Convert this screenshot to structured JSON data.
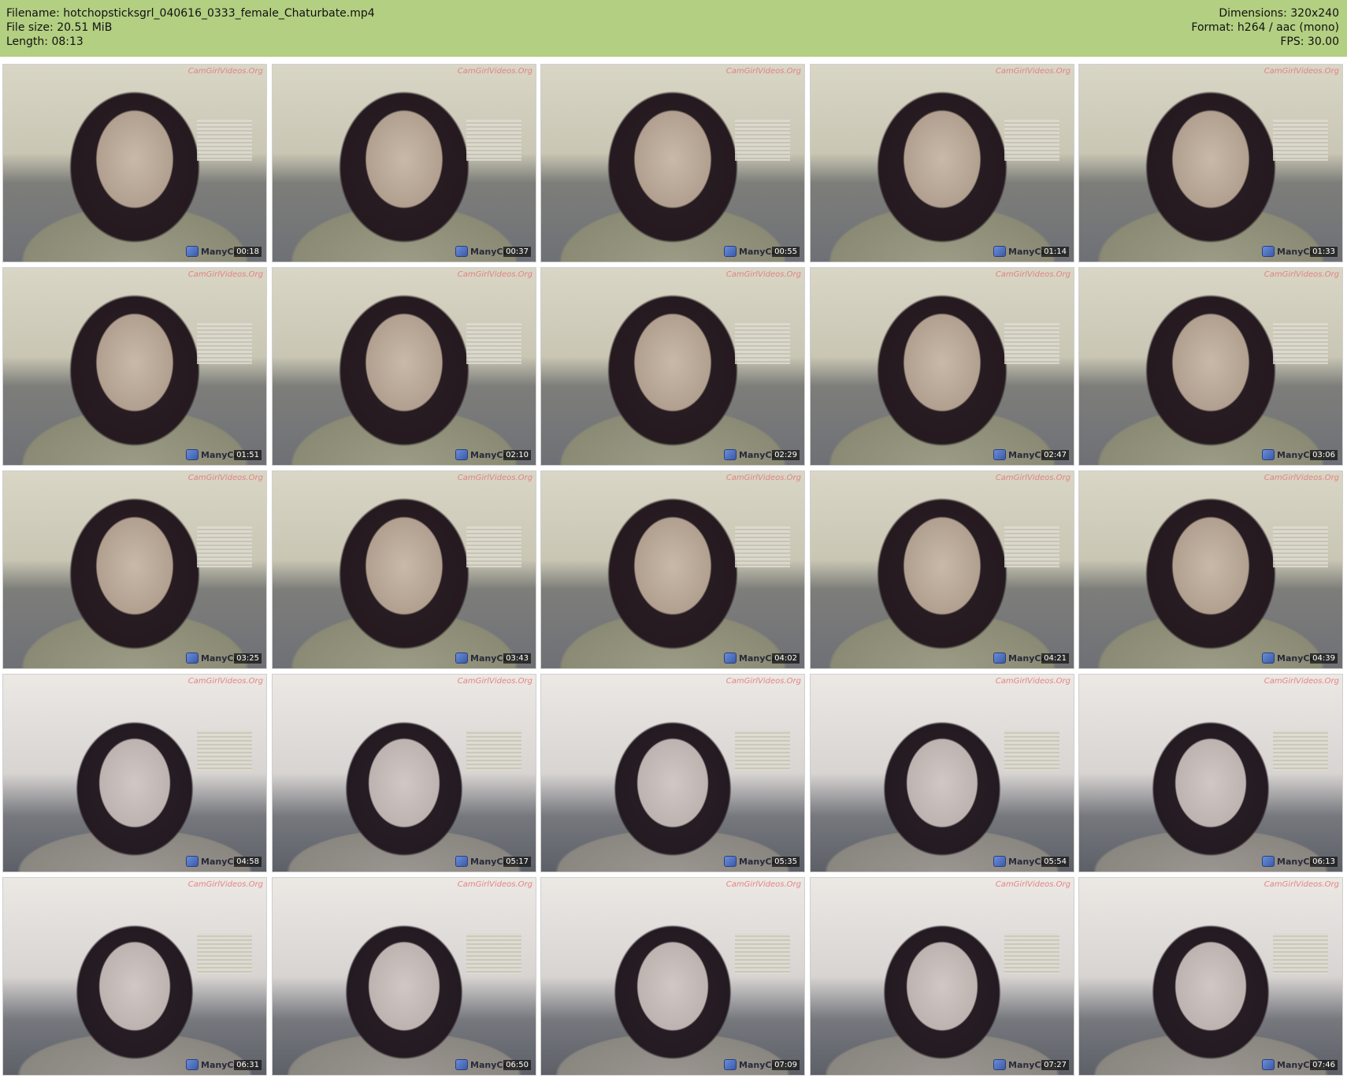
{
  "header": {
    "filename": "Filename: hotchopsticksgrl_040616_0333_female_Chaturbate.mp4",
    "file_size": "File size: 20.51 MiB",
    "length": "Length: 08:13",
    "dimensions": "Dimensions: 320x240",
    "format": "Format: h264 / aac (mono)",
    "fps": "FPS: 30.00"
  },
  "colors": {
    "header_bg": "#b3cf82",
    "page_bg": "#ffffff"
  },
  "overlay": {
    "watermark": "CamGirlVideos.Org",
    "cam_logo": "ManyCa"
  },
  "thumbnails": [
    {
      "time": "00:18"
    },
    {
      "time": "00:37"
    },
    {
      "time": "00:55"
    },
    {
      "time": "01:14"
    },
    {
      "time": "01:33"
    },
    {
      "time": "01:51"
    },
    {
      "time": "02:10"
    },
    {
      "time": "02:29"
    },
    {
      "time": "02:47"
    },
    {
      "time": "03:06"
    },
    {
      "time": "03:25"
    },
    {
      "time": "03:43"
    },
    {
      "time": "04:02"
    },
    {
      "time": "04:21"
    },
    {
      "time": "04:39"
    },
    {
      "time": "04:58"
    },
    {
      "time": "05:17"
    },
    {
      "time": "05:35"
    },
    {
      "time": "05:54"
    },
    {
      "time": "06:13"
    },
    {
      "time": "06:31"
    },
    {
      "time": "06:50"
    },
    {
      "time": "07:09"
    },
    {
      "time": "07:27"
    },
    {
      "time": "07:46"
    }
  ]
}
